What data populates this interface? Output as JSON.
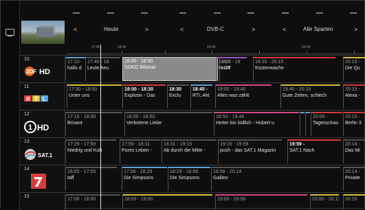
{
  "header": {
    "day": {
      "label": "Heute",
      "prev": "<",
      "next": ">"
    },
    "source": {
      "label": "DVB-C",
      "prev": "<",
      "next": ">"
    },
    "genre": {
      "label": "Alle Sparten",
      "prev": "<",
      "next": ">"
    }
  },
  "timeline": {
    "current": "17:46",
    "marks": [
      "18:00",
      "19:00",
      "20:00"
    ]
  },
  "channels": [
    {
      "number": "10",
      "logo": "ZDF HD",
      "programs": [
        {
          "time": "17:10-",
          "title": "hallo d"
        },
        {
          "time": "17:40 - 18",
          "title": "Leute heu"
        },
        {
          "time": "18:00 - 18:50",
          "title": "SOKO Wismar"
        },
        {
          "time": "18:5",
          "title": "LOT"
        },
        {
          "time": "19:00 - 19",
          "title": "heute"
        },
        {
          "time": "19:25 - 20:15",
          "title": "Küstenwache"
        },
        {
          "time": "20:15 -",
          "title": "Die Qu"
        }
      ]
    },
    {
      "number": "11",
      "logo": "RTL",
      "programs": [
        {
          "time": "17:30 - 18:00",
          "title": "Unter uns"
        },
        {
          "time": "18:00 - 18:30",
          "title": "Explosiv - Das"
        },
        {
          "time": "18:30",
          "title": "Exclu"
        },
        {
          "time": "18:45 -",
          "title": "RTL Akt"
        },
        {
          "time": "19:05 - 19:40",
          "title": "Alles was zählt"
        },
        {
          "time": "19:40 - 20:15",
          "title": "Gute Zeiten, schlech"
        },
        {
          "time": "20:15 -",
          "title": "Alexa -"
        }
      ]
    },
    {
      "number": "12",
      "logo": "1 HD",
      "programs": [
        {
          "time": "17:15 - 18:00",
          "title": "Brisant"
        },
        {
          "time": "18:00 - 18:50",
          "title": "Verbotene Liebe"
        },
        {
          "time": "18:50 - 19:45",
          "title": "Heiter bis tödlich - Hubert u"
        },
        {
          "time": "",
          "title": ""
        },
        {
          "time": "",
          "title": ""
        },
        {
          "time": "20:00 -",
          "title": "Tagesschau"
        },
        {
          "time": "20:15 -",
          "title": "Berlin 3"
        }
      ]
    },
    {
      "number": "13",
      "logo": "SAT.1",
      "programs": [
        {
          "time": "17:29 - 17:59",
          "title": "Niedrig und Kuh"
        },
        {
          "time": "17:59 - 18:31",
          "title": "Pures Leben -"
        },
        {
          "time": "18:31 - 19:15",
          "title": "Ab durch die Mitte -"
        },
        {
          "time": "19:15 - 19:59",
          "title": "push - das SAT.1 Magazin"
        },
        {
          "time": "19:59 -",
          "title": "SAT.1 Nach"
        },
        {
          "time": "20:14 -",
          "title": "Das Mi"
        }
      ]
    },
    {
      "number": "14",
      "logo": "ProSieben",
      "programs": [
        {
          "time": "16:55 - 17:55",
          "title": "taff"
        },
        {
          "time": "17:58 - 18:29",
          "title": "Die Simpsons"
        },
        {
          "time": "18:29 - 18:58",
          "title": "Die Simpsons"
        },
        {
          "time": "18:58 - 20:14",
          "title": "Galileo"
        },
        {
          "time": "20:14 -",
          "title": "Private"
        }
      ]
    },
    {
      "number": "15",
      "logo": "",
      "programs": [
        {
          "time": "17:00 - 18:00",
          "title": ""
        },
        {
          "time": "18:00 - 19:00",
          "title": ""
        },
        {
          "time": "19:00 - 20:00",
          "title": ""
        },
        {
          "time": "20:00 - 20:15",
          "title": ""
        },
        {
          "time": "20:15",
          "title": ""
        }
      ]
    }
  ],
  "colors": {
    "red": "#d83a3a",
    "blue": "#5aa2d8",
    "purple": "#9a5bc8",
    "yellow": "#d8c437",
    "pink": "#d84a8a",
    "green": "#6fbf5a"
  }
}
